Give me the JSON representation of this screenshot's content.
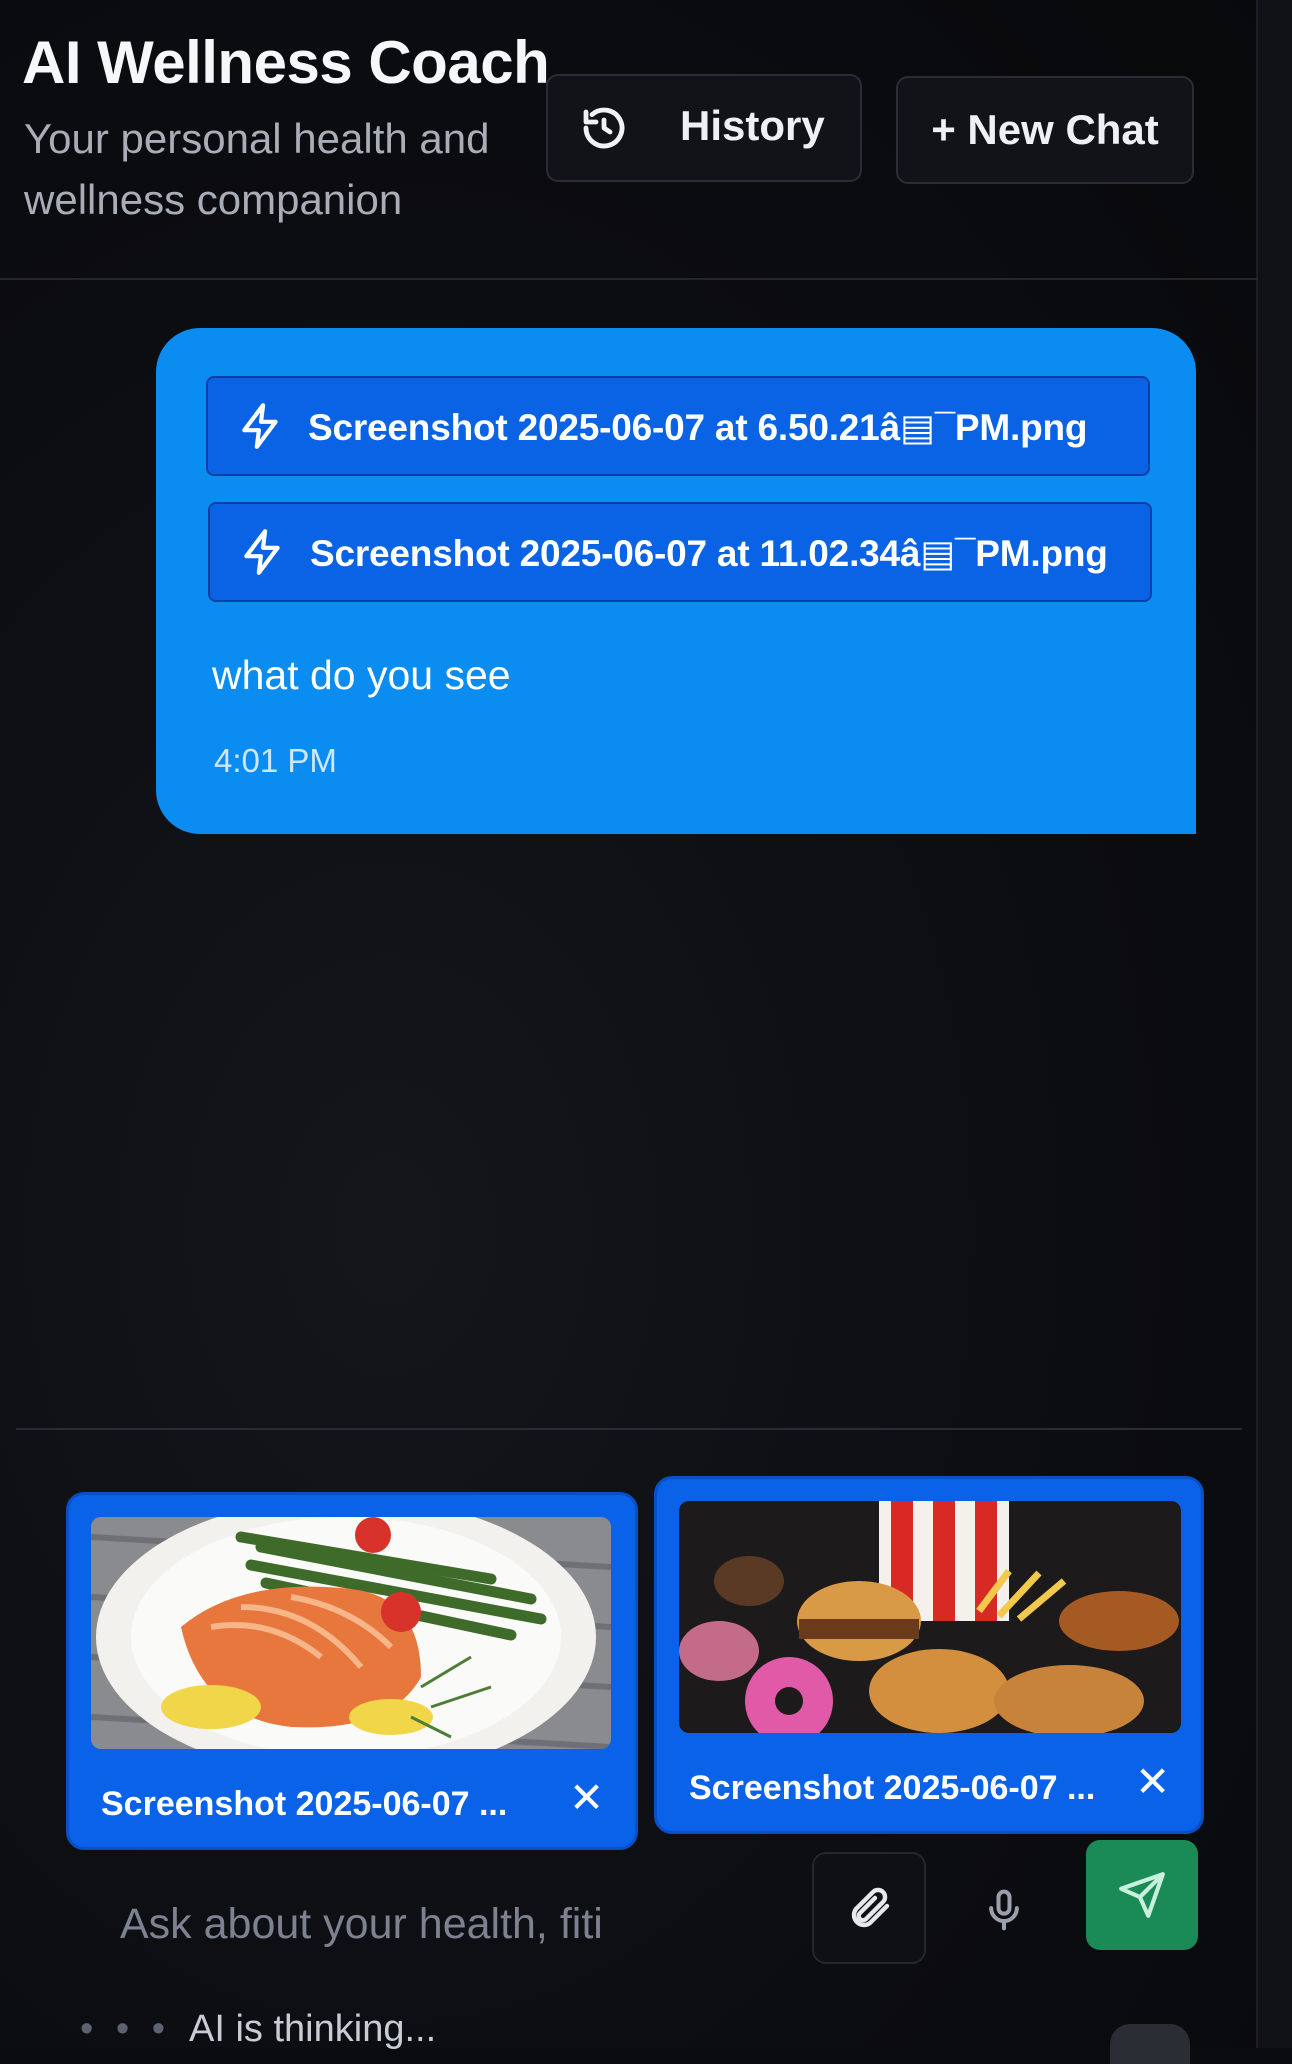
{
  "header": {
    "title": "AI Wellness Coach",
    "subtitle": "Your personal health and wellness companion",
    "history_label": "History",
    "new_chat_label": "+ New Chat"
  },
  "message": {
    "attachments": [
      {
        "name": "Screenshot 2025-06-07 at 6.50.21â▤¯PM.png",
        "icon": "lightning-icon"
      },
      {
        "name": "Screenshot 2025-06-07 at 11.02.34â▤¯PM.png",
        "icon": "lightning-icon"
      }
    ],
    "text": "what do you see",
    "time": "4:01 PM"
  },
  "pending_attachments": [
    {
      "label": "Screenshot 2025-06-07 ...",
      "close": "✕",
      "image": "salmon-asparagus-plate"
    },
    {
      "label": "Screenshot 2025-06-07 ...",
      "close": "✕",
      "image": "fast-food-burgers-fries-donut"
    }
  ],
  "composer": {
    "placeholder": "Ask about your health, fiti",
    "attach_icon": "paperclip-icon",
    "mic_icon": "microphone-icon",
    "send_icon": "send-icon"
  },
  "status": {
    "dots": "• • •",
    "thinking": "AI is thinking..."
  },
  "colors": {
    "bubble": "#0a8cf0",
    "attachment": "#0a63e4",
    "send_button": "#1a8a57",
    "background": "#0b0c0f"
  }
}
